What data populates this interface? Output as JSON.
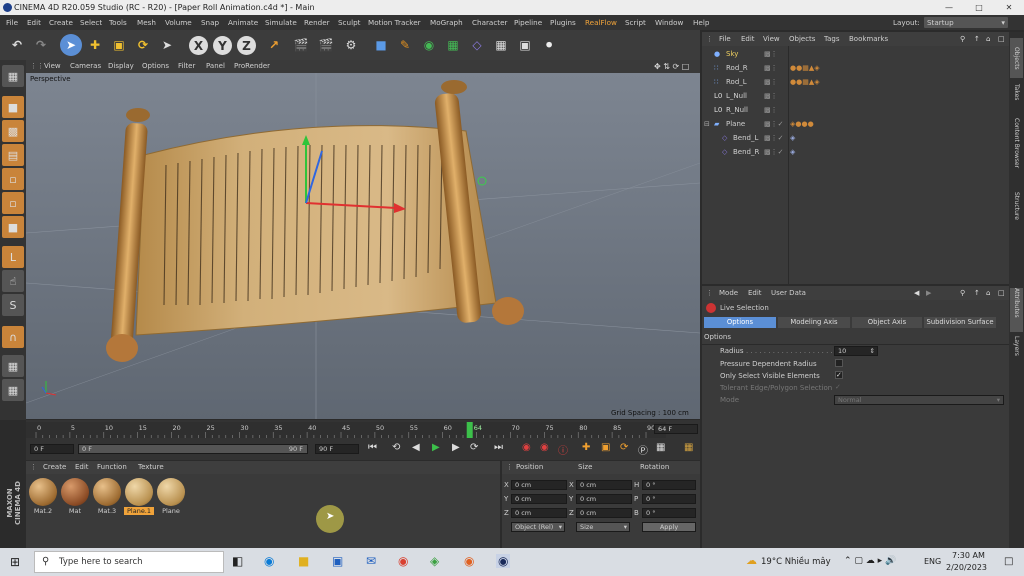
{
  "window": {
    "title": "CINEMA 4D R20.059 Studio (RC - R20) - [Paper Roll Animation.c4d *] - Main"
  },
  "menubar": {
    "items": [
      "File",
      "Edit",
      "Create",
      "Select",
      "Tools",
      "Mesh",
      "Volume",
      "Snap",
      "Animate",
      "Simulate",
      "Render",
      "Sculpt",
      "Motion Tracker",
      "MoGraph",
      "Character",
      "Pipeline",
      "Plugins",
      "RealFlow",
      "Script",
      "Window",
      "Help"
    ],
    "layout_label": "Layout:",
    "layout_value": "Startup"
  },
  "viewport": {
    "menu": [
      "View",
      "Cameras",
      "Display",
      "Options",
      "Filter",
      "Panel",
      "ProRender"
    ],
    "camera": "Perspective",
    "grid_spacing": "Grid Spacing : 100 cm"
  },
  "object_manager": {
    "menu": [
      "File",
      "Edit",
      "View",
      "Objects",
      "Tags",
      "Bookmarks"
    ],
    "objects": [
      {
        "name": "Sky",
        "indent": 0
      },
      {
        "name": "Rod_R",
        "indent": 0
      },
      {
        "name": "Rod_L",
        "indent": 0
      },
      {
        "name": "L_Null",
        "indent": 0
      },
      {
        "name": "R_Null",
        "indent": 0
      },
      {
        "name": "Plane",
        "indent": 0
      },
      {
        "name": "Bend_L",
        "indent": 1
      },
      {
        "name": "Bend_R",
        "indent": 1
      }
    ]
  },
  "attribute_manager": {
    "menu": [
      "Mode",
      "Edit",
      "User Data"
    ],
    "tool": "Live Selection",
    "tabs": [
      "Options",
      "Modeling Axis",
      "Object Axis",
      "Subdivision Surface"
    ],
    "section": "Options",
    "radius_label": "Radius",
    "radius_value": "10",
    "pressure_label": "Pressure Dependent Radius",
    "only_visible_label": "Only Select Visible Elements",
    "tolerant_label": "Tolerant Edge/Polygon Selection",
    "mode_label": "Mode",
    "mode_value": "Normal"
  },
  "side_tabs": [
    "Objects",
    "Takes",
    "Content Browser",
    "Structure",
    "Attributes",
    "Layers"
  ],
  "timeline": {
    "ticks": [
      "0",
      "5",
      "10",
      "15",
      "20",
      "25",
      "30",
      "35",
      "40",
      "45",
      "50",
      "55",
      "60",
      "64",
      "70",
      "75",
      "80",
      "85",
      "90"
    ],
    "current_frame": "64 F",
    "start": "0 F",
    "start2": "0 F",
    "end": "90 F",
    "end2": "90 F",
    "playhead_fraction": 0.711
  },
  "material_manager": {
    "menu": [
      "Create",
      "Edit",
      "Function",
      "Texture"
    ],
    "materials": [
      {
        "name": "Mat.2",
        "selected": false
      },
      {
        "name": "Mat",
        "selected": false
      },
      {
        "name": "Mat.3",
        "selected": false
      },
      {
        "name": "Plane.1",
        "selected": true
      },
      {
        "name": "Plane",
        "selected": false
      }
    ]
  },
  "coordinates": {
    "headers": [
      "Position",
      "Size",
      "Rotation"
    ],
    "rows": [
      {
        "axis": "X",
        "pos": "0 cm",
        "saxis": "X",
        "size": "0 cm",
        "raxis": "H",
        "rot": "0 °"
      },
      {
        "axis": "Y",
        "pos": "0 cm",
        "saxis": "Y",
        "size": "0 cm",
        "raxis": "P",
        "rot": "0 °"
      },
      {
        "axis": "Z",
        "pos": "0 cm",
        "saxis": "Z",
        "size": "0 cm",
        "raxis": "B",
        "rot": "0 °"
      }
    ],
    "mode": "Object (Rel)",
    "size_mode": "Size",
    "apply": "Apply"
  },
  "brand": {
    "line1": "MAXON",
    "line2": "CINEMA 4D"
  },
  "taskbar": {
    "search": "Type here to search",
    "weather": "19°C  Nhiều mây",
    "lang": "ENG",
    "time": "7:30 AM",
    "date": "2/20/2023"
  },
  "colors": {
    "accent_blue": "#5b8fd6",
    "realflow": "#f0a33a",
    "selected_mat": "#f0a33a"
  }
}
